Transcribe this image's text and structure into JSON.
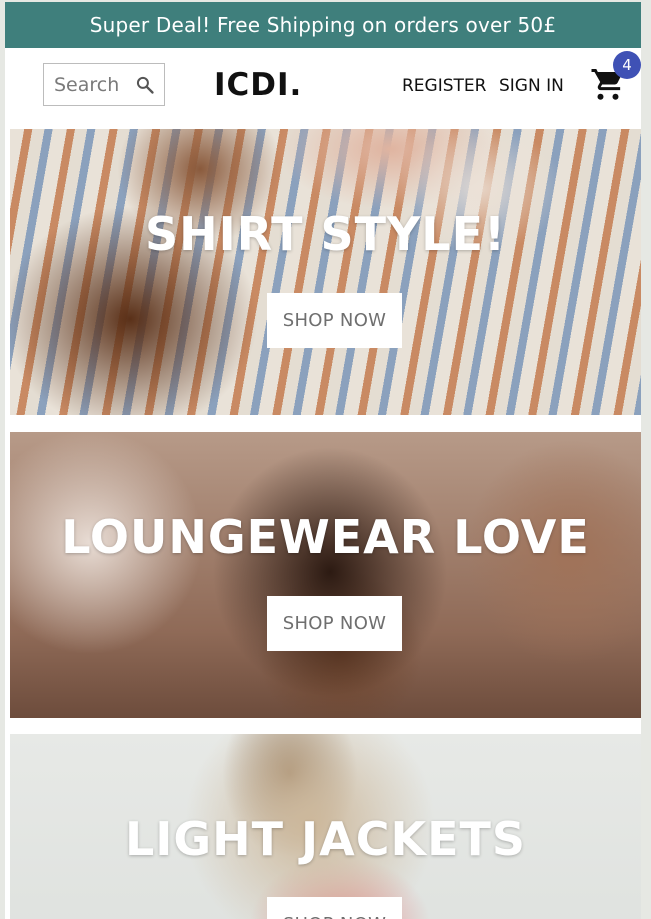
{
  "announcement": "Super Deal! Free Shipping on orders over 50£",
  "search": {
    "placeholder": "Search"
  },
  "logo": "ICDI.",
  "nav": {
    "register": "REGISTER",
    "sign_in": "SIGN IN"
  },
  "cart": {
    "count": "4",
    "icon": "shopping-cart-icon"
  },
  "heroes": [
    {
      "title": "SHIRT STYLE!",
      "button": "SHOP NOW"
    },
    {
      "title": "LOUNGEWEAR LOVE",
      "button": "SHOP NOW"
    },
    {
      "title": "LIGHT JACKETS",
      "button": "SHOP NOW"
    }
  ],
  "colors": {
    "announcement_bg": "#3f7f7c",
    "badge_bg": "#3f51b5"
  }
}
